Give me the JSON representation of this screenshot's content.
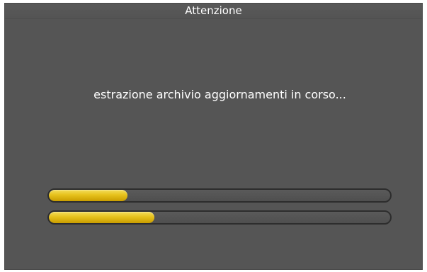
{
  "dialog": {
    "title": "Attenzione",
    "message": "estrazione archivio aggiornamenti in corso..."
  },
  "progress": [
    {
      "value": 0.23
    },
    {
      "value": 0.31
    }
  ],
  "colors": {
    "dialog_background": "#555555",
    "text": "#ffffff",
    "progress_fill": "#e6c11c",
    "progress_track": "#555555"
  }
}
